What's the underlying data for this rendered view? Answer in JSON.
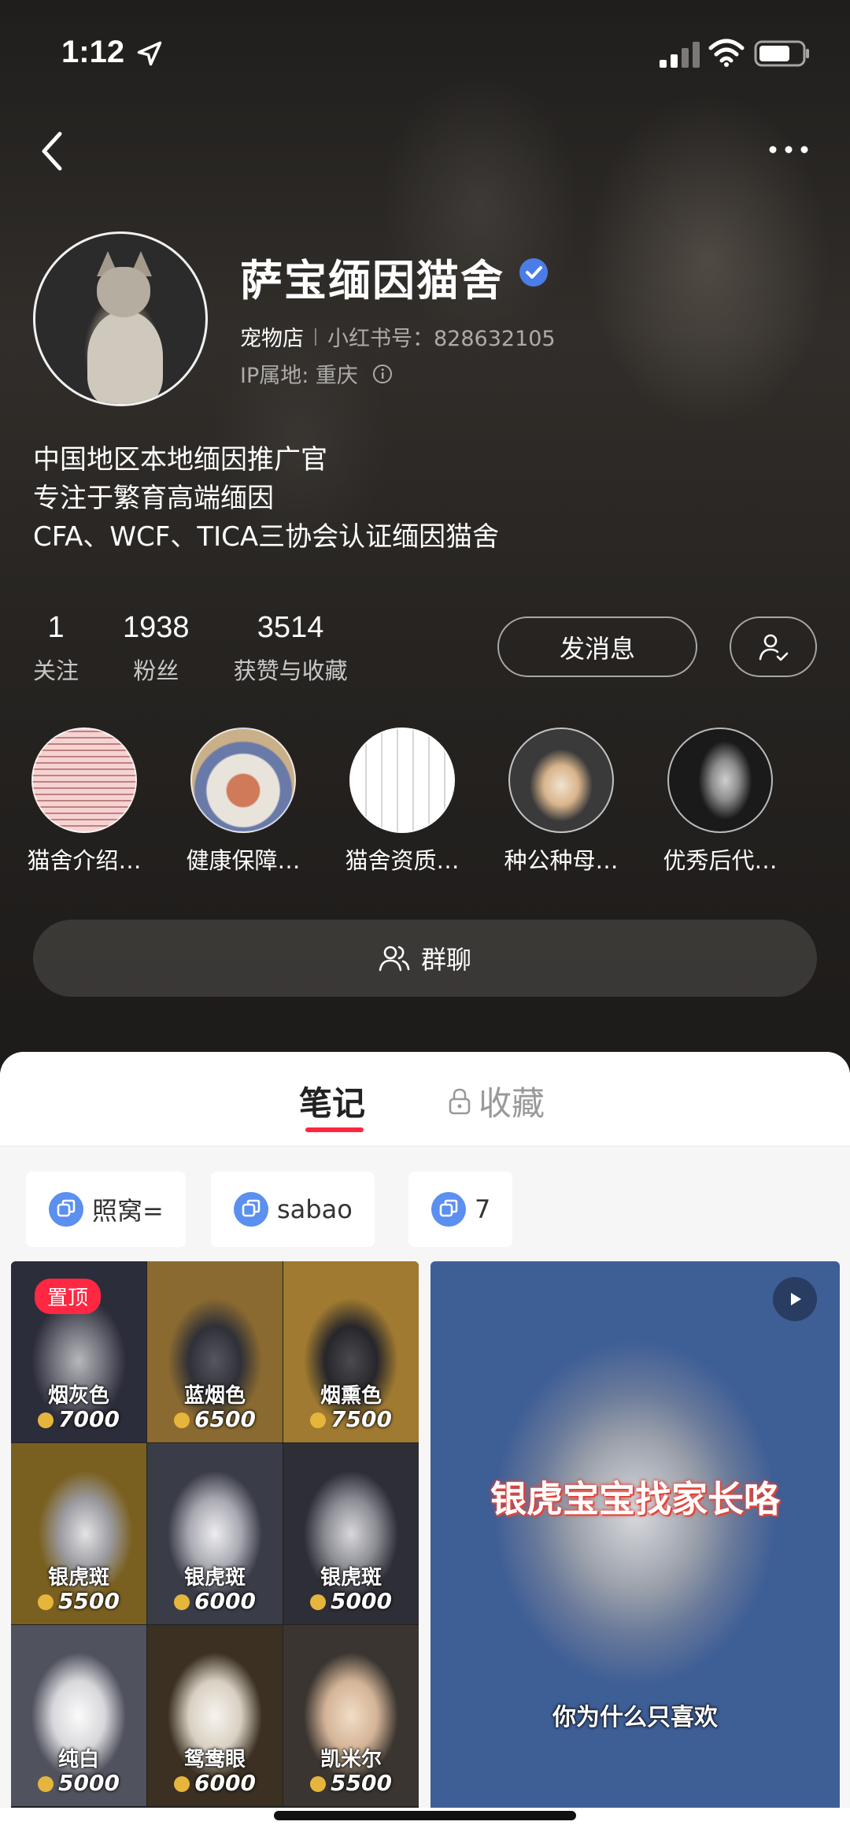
{
  "status_bar": {
    "time": "1:12"
  },
  "profile": {
    "name": "萨宝缅因猫舍",
    "category": "宠物店",
    "redbook_id": "小红书号：828632105",
    "ip_location": "IP属地: 重庆",
    "bio": [
      "中国地区本地缅因推广官",
      "专注于繁育高端缅因",
      "CFA、WCF、TICA三协会认证缅因猫舍"
    ]
  },
  "stats": [
    {
      "value": "1",
      "label": "关注"
    },
    {
      "value": "1938",
      "label": "粉丝"
    },
    {
      "value": "3514",
      "label": "获赞与收藏"
    }
  ],
  "actions": {
    "message_label": "发消息"
  },
  "highlights": [
    {
      "label": "猫舍介绍…"
    },
    {
      "label": "健康保障…"
    },
    {
      "label": "猫舍资质…"
    },
    {
      "label": "种公种母…"
    },
    {
      "label": "优秀后代…"
    }
  ],
  "group_chat": {
    "label": "群聊"
  },
  "tabs": {
    "notes": "笔记",
    "favorites": "收藏"
  },
  "collections": [
    {
      "label": "照窝="
    },
    {
      "label": "sabao"
    },
    {
      "label": "7"
    }
  ],
  "notes": {
    "pinned_label": "置顶",
    "grid": [
      {
        "name": "烟灰色",
        "price": "7000"
      },
      {
        "name": "蓝烟色",
        "price": "6500"
      },
      {
        "name": "烟熏色",
        "price": "7500"
      },
      {
        "name": "银虎斑",
        "price": "5500"
      },
      {
        "name": "银虎斑",
        "price": "6000"
      },
      {
        "name": "银虎斑",
        "price": "5000"
      },
      {
        "name": "纯白",
        "price": "5000"
      },
      {
        "name": "鸳鸯眼",
        "price": "6000"
      },
      {
        "name": "凯米尔",
        "price": "5500"
      }
    ],
    "video_card": {
      "overlay": "银虎宝宝找家长咯",
      "subtitle": "你为什么只喜欢"
    }
  },
  "colors": {
    "accent": "#ff2741",
    "verified": "#4a7de8",
    "chip_icon": "#5b8ff0"
  }
}
